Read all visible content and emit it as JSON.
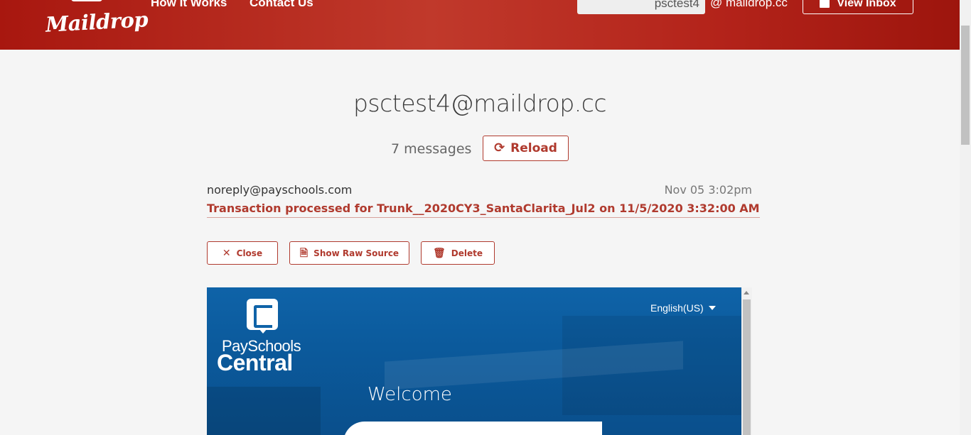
{
  "header": {
    "logo": "Maildrop",
    "nav": [
      {
        "label": "How It Works"
      },
      {
        "label": "Contact Us"
      }
    ],
    "inbox_input_value": "psctest4",
    "domain_suffix": "@ maildrop.cc",
    "view_inbox_label": "View Inbox"
  },
  "inbox": {
    "address": "psctest4@maildrop.cc",
    "message_count": "7 messages",
    "reload_label": "Reload"
  },
  "message": {
    "sender": "noreply@payschools.com",
    "date": "Nov 05 3:02pm",
    "subject": "Transaction processed for Trunk__2020CY3_SantaClarita_Jul2 on 11/5/2020 3:32:00 AM"
  },
  "actions": {
    "close_label": "Close",
    "raw_label": "Show Raw Source",
    "delete_label": "Delete"
  },
  "email_preview": {
    "brand_line1": "PaySchools",
    "brand_line2": "Central",
    "language": "English(US)",
    "welcome": "Welcome"
  },
  "icons": {
    "reload": "refresh-icon",
    "close": "x-icon",
    "raw": "document-icon",
    "delete": "trash-icon",
    "inbox": "inbox-tray-icon"
  },
  "colors": {
    "brand_red": "#b03a2e",
    "header_red": "#c0392b",
    "email_blue": "#0f63a8"
  }
}
